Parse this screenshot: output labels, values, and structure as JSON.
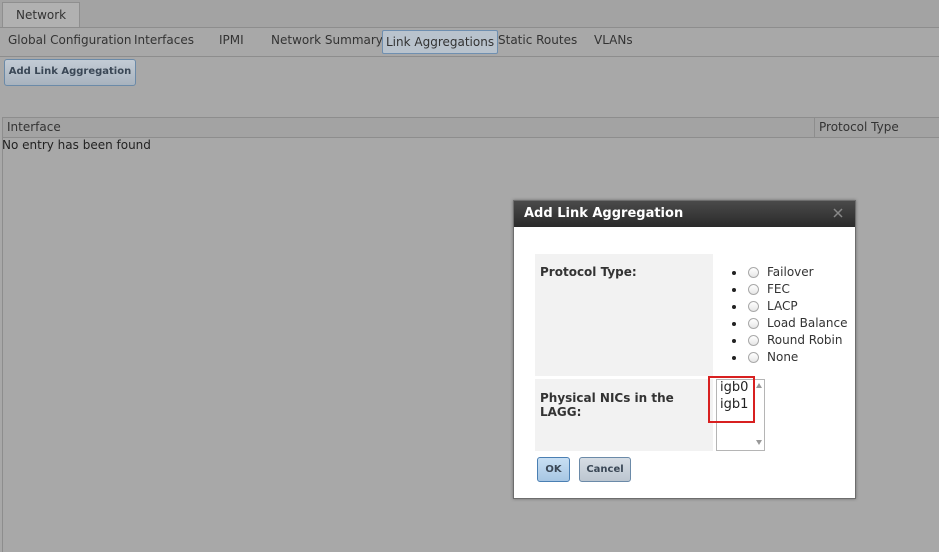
{
  "main_tabs": [
    "Network"
  ],
  "sub_tabs": [
    "Global Configuration",
    "Interfaces",
    "IPMI",
    "Network Summary",
    "Link Aggregations",
    "Static Routes",
    "VLANs"
  ],
  "active_sub_tab": "Link Aggregations",
  "toolbar": {
    "add_label": "Add Link Aggregation"
  },
  "grid": {
    "columns": [
      "Interface",
      "Protocol Type"
    ],
    "empty_message": "No entry has been found"
  },
  "dialog": {
    "title": "Add Link Aggregation",
    "protocol_label": "Protocol Type:",
    "protocol_options": [
      "Failover",
      "FEC",
      "LACP",
      "Load Balance",
      "Round Robin",
      "None"
    ],
    "nics_label": "Physical NICs in the LAGG:",
    "nics_options": [
      "igb0",
      "igb1"
    ],
    "ok_label": "OK",
    "cancel_label": "Cancel"
  },
  "icons": {
    "close": "close-icon"
  },
  "colors": {
    "highlight": "#d82020",
    "title_bar": "#2a2a2a",
    "accent": "#6f8fb0"
  }
}
